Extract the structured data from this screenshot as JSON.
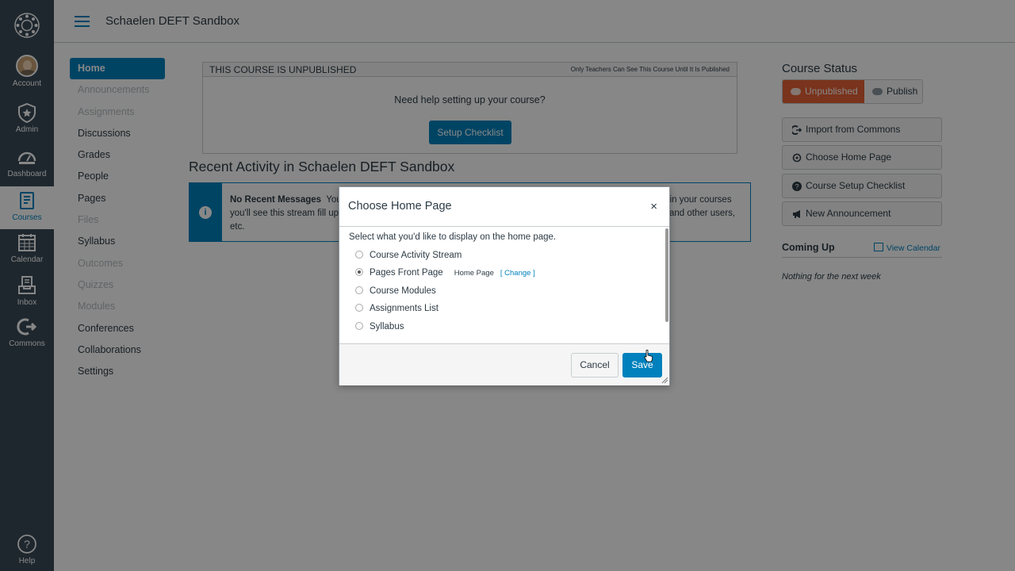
{
  "global_nav": {
    "items": [
      {
        "label": "Account",
        "icon": "avatar"
      },
      {
        "label": "Admin",
        "icon": "shield-icon"
      },
      {
        "label": "Dashboard",
        "icon": "dashboard-icon"
      },
      {
        "label": "Courses",
        "icon": "book-icon",
        "active": true
      },
      {
        "label": "Calendar",
        "icon": "calendar-icon"
      },
      {
        "label": "Inbox",
        "icon": "inbox-icon"
      },
      {
        "label": "Commons",
        "icon": "commons-icon"
      }
    ],
    "help_label": "Help"
  },
  "header": {
    "breadcrumb": "Schaelen DEFT Sandbox"
  },
  "course_nav": {
    "items": [
      {
        "label": "Home",
        "state": "current"
      },
      {
        "label": "Announcements",
        "state": "hidden"
      },
      {
        "label": "Assignments",
        "state": "hidden"
      },
      {
        "label": "Discussions",
        "state": "visible"
      },
      {
        "label": "Grades",
        "state": "visible"
      },
      {
        "label": "People",
        "state": "visible"
      },
      {
        "label": "Pages",
        "state": "visible"
      },
      {
        "label": "Files",
        "state": "hidden"
      },
      {
        "label": "Syllabus",
        "state": "visible"
      },
      {
        "label": "Outcomes",
        "state": "hidden"
      },
      {
        "label": "Quizzes",
        "state": "hidden"
      },
      {
        "label": "Modules",
        "state": "hidden"
      },
      {
        "label": "Conferences",
        "state": "visible"
      },
      {
        "label": "Collaborations",
        "state": "visible"
      },
      {
        "label": "Settings",
        "state": "visible"
      }
    ]
  },
  "main": {
    "unpublished_title": "THIS COURSE IS UNPUBLISHED",
    "unpublished_note": "Only Teachers Can See This Course Until It Is Published",
    "help_text": "Need help setting up your course?",
    "setup_button": "Setup Checklist",
    "recent_title": "Recent Activity in Schaelen DEFT Sandbox",
    "alert_bold": "No Recent Messages",
    "alert_text_1": "You",
    "alert_text_1b": "g in your courses",
    "alert_text_2": "you'll see this stream fill up",
    "alert_text_2b": "and other users,",
    "alert_text_3": "etc."
  },
  "sidebar": {
    "status_title": "Course Status",
    "unpublished_button": "Unpublished",
    "publish_button": "Publish",
    "buttons": [
      {
        "label": "Import from Commons",
        "icon": "import-icon"
      },
      {
        "label": "Choose Home Page",
        "icon": "home-page-icon"
      },
      {
        "label": "Course Setup Checklist",
        "icon": "question-icon"
      },
      {
        "label": "New Announcement",
        "icon": "megaphone-icon"
      }
    ],
    "coming_up": "Coming Up",
    "view_calendar": "View Calendar",
    "nothing_text": "Nothing for the next week"
  },
  "dialog": {
    "title": "Choose Home Page",
    "close": "×",
    "intro": "Select what you'd like to display on the home page.",
    "options": [
      {
        "label": "Course Activity Stream",
        "selected": false
      },
      {
        "label": "Pages Front Page",
        "selected": true
      },
      {
        "label": "Course Modules",
        "selected": false
      },
      {
        "label": "Assignments List",
        "selected": false
      },
      {
        "label": "Syllabus",
        "selected": false
      }
    ],
    "front_page_name": "Home Page",
    "change_link": "[ Change ]",
    "cancel": "Cancel",
    "save": "Save"
  },
  "colors": {
    "nav_bg": "#394b58",
    "brand_blue": "#0081bd",
    "unpublished_red": "#e66135"
  }
}
